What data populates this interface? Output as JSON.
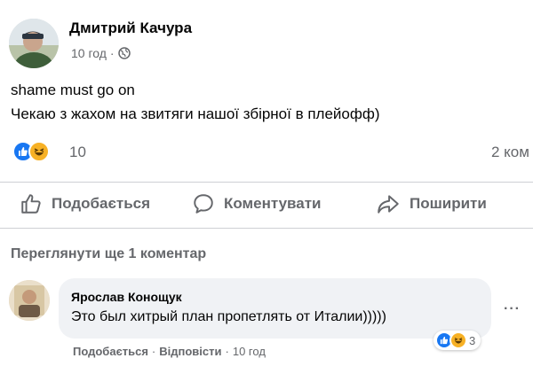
{
  "post": {
    "author": "Дмитрий Качура",
    "time": "10 год",
    "separator": "·",
    "audience_icon": "globe-icon",
    "lines": [
      "shame must go on",
      "Чекаю з жахом на звитяги нашої збірної в плейофф)"
    ],
    "reactions": {
      "icons": [
        "like-icon",
        "haha-icon"
      ],
      "count": "10"
    },
    "comments_count": "2 ком"
  },
  "actions": {
    "like": "Подобається",
    "comment": "Коментувати",
    "share": "Поширити"
  },
  "view_more": "Переглянути ще 1 коментар",
  "comment": {
    "author": "Ярослав Конощук",
    "text": "Это был хитрый план пропетлять от Италии)))))",
    "like": "Подобається",
    "separator": "·",
    "reply": "Відповісти",
    "time": "10 год",
    "reactions_count": "3",
    "more": "···"
  },
  "colors": {
    "like_blue": "#1877f2",
    "haha_yellow": "#f7b125",
    "muted": "#65676b",
    "bubble": "#f0f2f5"
  }
}
